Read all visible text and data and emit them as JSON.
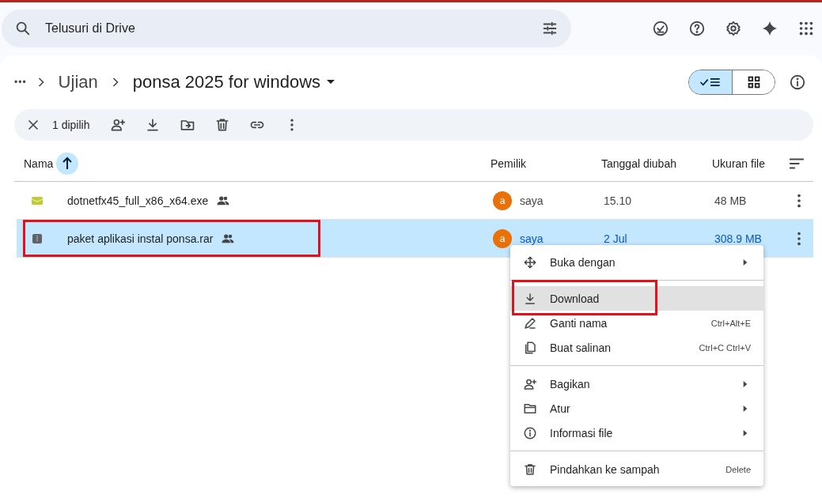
{
  "search": {
    "placeholder": "Telusuri di Drive"
  },
  "breadcrumb": {
    "more": "•••",
    "items": [
      "Ujian",
      "ponsa 2025 for windows"
    ]
  },
  "view_toggle": [
    {
      "kind": "list",
      "selected": true
    },
    {
      "kind": "grid",
      "selected": false
    }
  ],
  "selection_bar": {
    "count": "1 dipilih"
  },
  "table": {
    "columns": [
      "Nama",
      "Pemilik",
      "Tanggal diubah",
      "Ukuran file"
    ],
    "rows": [
      {
        "kind": "exe",
        "name": "dotnetfx45_full_x86_x64.exe",
        "shared": true,
        "owner_initial": "a",
        "owner": "saya",
        "modified": "15.10",
        "size": "48 MB",
        "selected": false,
        "annotated": false
      },
      {
        "kind": "archive",
        "name": "paket aplikasi instal ponsa.rar",
        "shared": true,
        "owner_initial": "a",
        "owner": "saya",
        "modified": "2 Jul",
        "size": "308.9 MB",
        "selected": true,
        "annotated": true
      }
    ]
  },
  "context_menu": [
    {
      "kind": "item",
      "label": "Buka dengan",
      "submenu": true,
      "hovered": false,
      "annotated": false
    },
    {
      "kind": "divider"
    },
    {
      "kind": "item",
      "label": "Download",
      "submenu": false,
      "hovered": true,
      "annotated": true
    },
    {
      "kind": "item",
      "label": "Ganti nama",
      "shortcut": "Ctrl+Alt+E",
      "submenu": false,
      "hovered": false,
      "annotated": false
    },
    {
      "kind": "item",
      "label": "Buat salinan",
      "shortcut": "Ctrl+C Ctrl+V",
      "submenu": false,
      "hovered": false,
      "annotated": false
    },
    {
      "kind": "divider"
    },
    {
      "kind": "item",
      "label": "Bagikan",
      "submenu": true,
      "hovered": false,
      "annotated": false
    },
    {
      "kind": "item",
      "label": "Atur",
      "submenu": true,
      "hovered": false,
      "annotated": false
    },
    {
      "kind": "item",
      "label": "Informasi file",
      "submenu": true,
      "hovered": false,
      "annotated": false
    },
    {
      "kind": "divider"
    },
    {
      "kind": "item",
      "label": "Pindahkan ke sampah",
      "shortcut": "Delete",
      "submenu": false,
      "hovered": false,
      "annotated": false
    }
  ]
}
